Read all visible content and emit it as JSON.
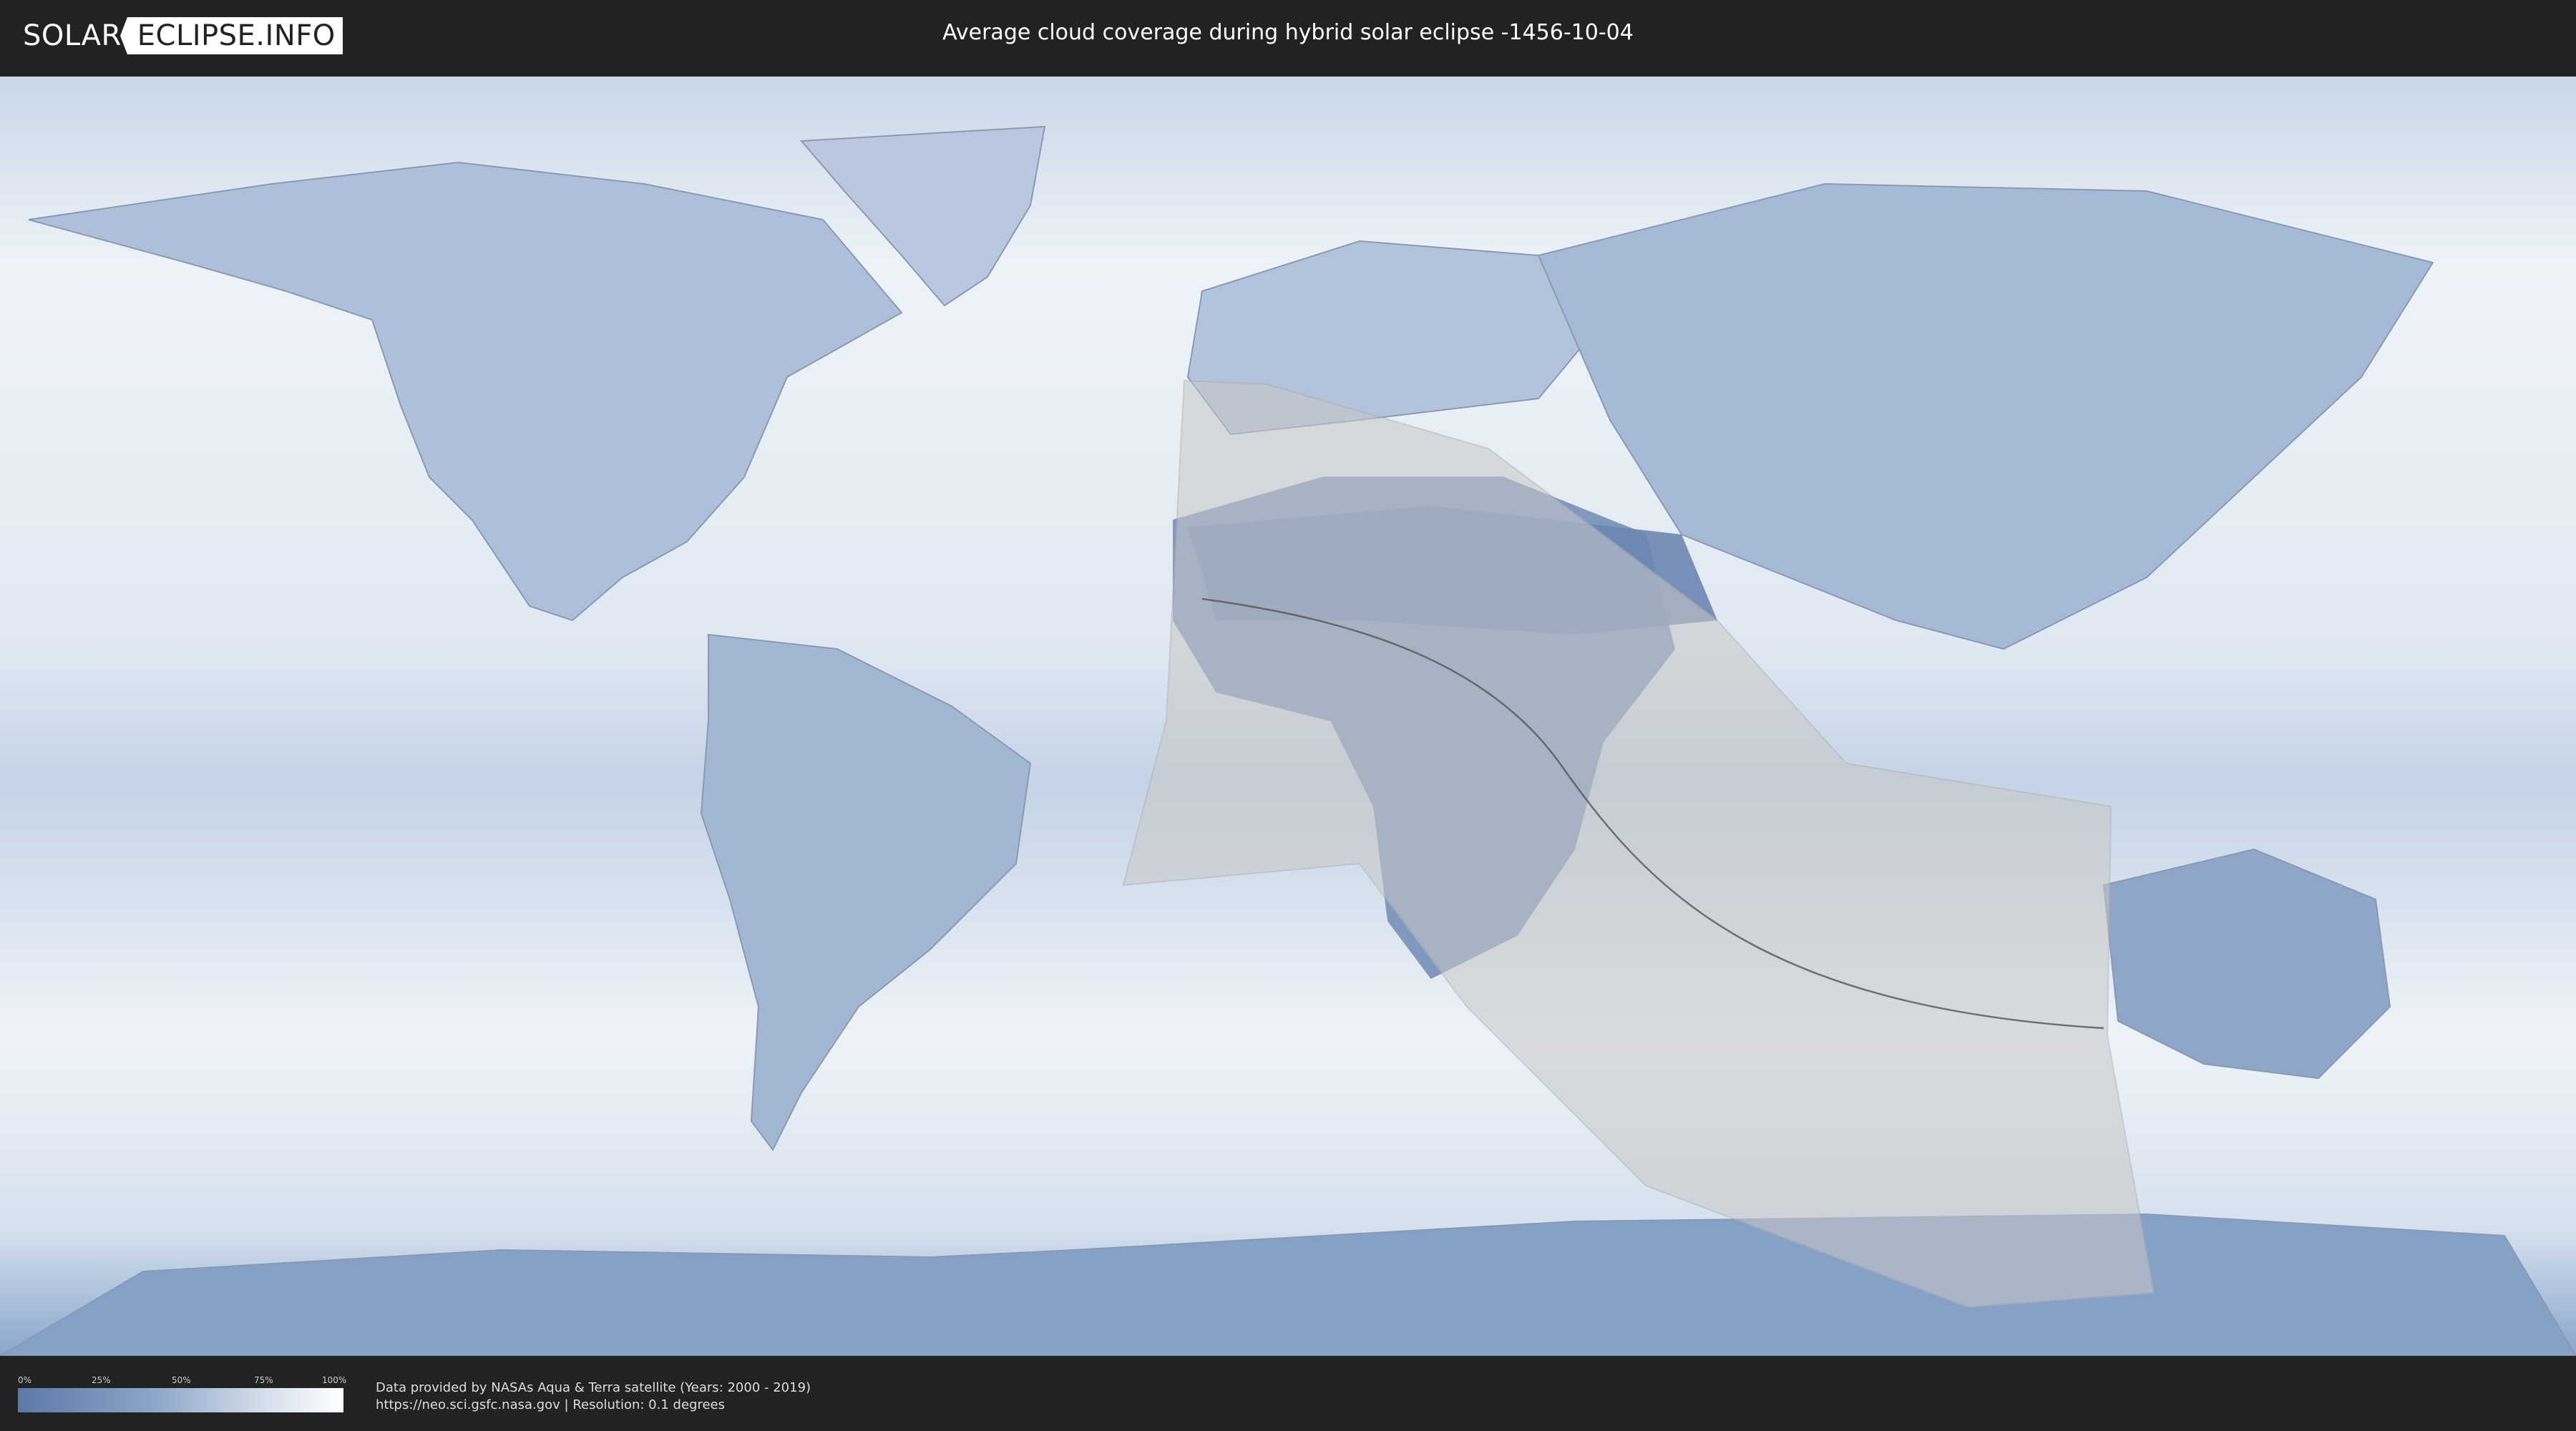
{
  "header": {
    "logo_left": "SOLAR",
    "logo_right": "ECLIPSE.INFO",
    "title": "Average cloud coverage during hybrid solar eclipse -1456-10-04"
  },
  "legend": {
    "ticks": [
      "0%",
      "25%",
      "50%",
      "75%",
      "100%"
    ],
    "colors": {
      "low": "#5c78a8",
      "high": "#ffffff"
    }
  },
  "footer": {
    "source_line1": "Data provided by NASAs Aqua & Terra satellite (Years: 2000 - 2019)",
    "source_line2": "https://neo.sci.gsfc.nasa.gov | Resolution: 0.1 degrees"
  },
  "map": {
    "colors": {
      "ocean_cloud": "#dde6f0",
      "land_clear": "#6d86b2",
      "land_mid": "#9fb4d3",
      "coast": "#8a9ab3",
      "eclipse_overlay": "#c8c8c8",
      "path": "#555555"
    }
  }
}
